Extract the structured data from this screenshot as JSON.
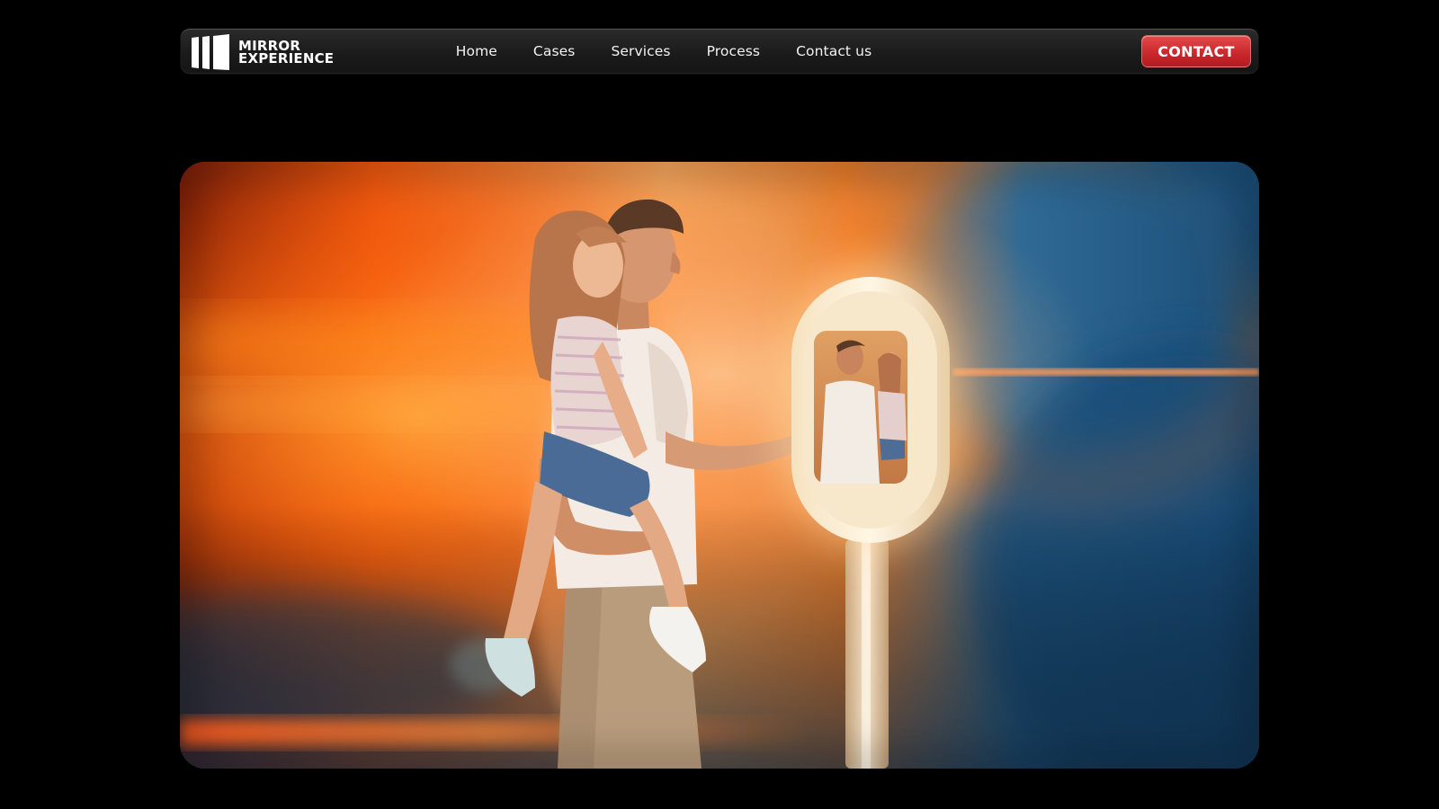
{
  "brand": {
    "line1": "MIRROR",
    "line2": "EXPERIENCE"
  },
  "nav": {
    "items": [
      {
        "label": "Home"
      },
      {
        "label": "Cases"
      },
      {
        "label": "Services"
      },
      {
        "label": "Process"
      },
      {
        "label": "Contact us"
      }
    ]
  },
  "cta": {
    "label": "CONTACT",
    "color": "#d32f33"
  },
  "hero": {
    "scene": "father-holding-daughter-touching-selfie-mirror-booth",
    "colors": {
      "warm": "#ff7a1a",
      "cool": "#1e5c8c",
      "background": "#000000"
    }
  },
  "icons": {
    "logo": "mirror-experience-logo-icon"
  }
}
